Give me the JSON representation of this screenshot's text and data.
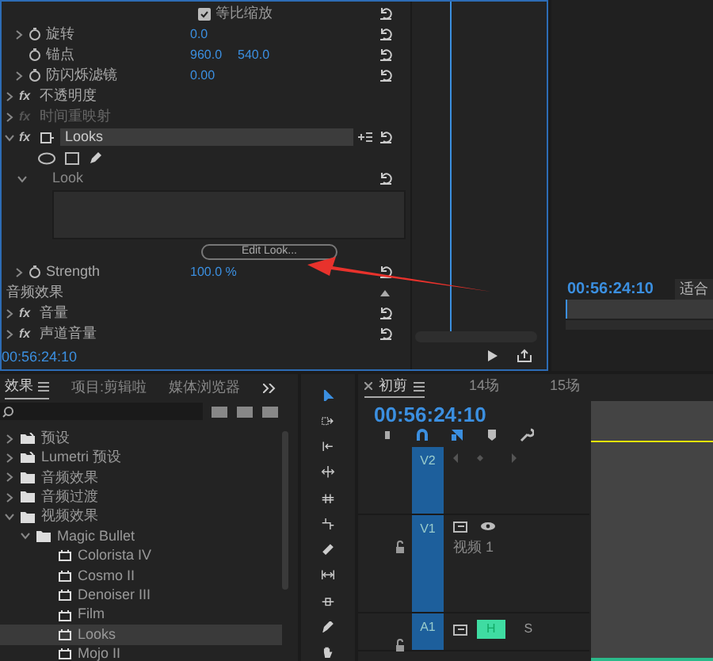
{
  "effect_controls": {
    "rows": [
      {
        "kind": "checkbox",
        "label": "等比缩放",
        "checked": true,
        "reset": true
      },
      {
        "kind": "param",
        "label": "旋转",
        "values": [
          "0.0"
        ],
        "expandable": true,
        "reset": true
      },
      {
        "kind": "param",
        "label": "锚点",
        "values": [
          "960.0",
          "540.0"
        ],
        "expandable": false,
        "reset": true
      },
      {
        "kind": "param",
        "label": "防闪烁滤镜",
        "values": [
          "0.00"
        ],
        "expandable": true,
        "reset": true
      },
      {
        "kind": "effect",
        "badge": "fx",
        "label": "不透明度",
        "expanded": false,
        "enabled": true,
        "selected": false,
        "reset": false
      },
      {
        "kind": "effect",
        "badge": "fx",
        "label": "时间重映射",
        "expanded": false,
        "enabled": false,
        "selected": false,
        "reset": false
      },
      {
        "kind": "effect",
        "badge": "fx",
        "label": "Looks",
        "expanded": true,
        "enabled": true,
        "selected": true,
        "reset": true
      },
      {
        "kind": "masks",
        "reset": false
      },
      {
        "kind": "group",
        "label": "Look",
        "expanded": true,
        "reset": true
      },
      {
        "kind": "preview",
        "reset": false
      },
      {
        "kind": "button",
        "label": "Edit Look...",
        "reset": false
      },
      {
        "kind": "param",
        "label": "Strength",
        "values": [
          "100.0 %"
        ],
        "expandable": true,
        "reset": true
      },
      {
        "kind": "section",
        "label": "音频效果",
        "reset": false
      },
      {
        "kind": "effect",
        "badge": "fx",
        "label": "音量",
        "expanded": false,
        "enabled": true,
        "selected": false,
        "reset": true
      },
      {
        "kind": "effect",
        "badge": "fx",
        "label": "声道音量",
        "expanded": false,
        "enabled": true,
        "selected": false,
        "reset": true
      }
    ],
    "timecode": "00:56:24:10"
  },
  "program_monitor": {
    "timecode": "00:56:24:10",
    "zoom": "适合"
  },
  "effects_panel": {
    "tabs": [
      {
        "label": "效果",
        "selected": true
      },
      {
        "label": "项目:剪辑啦",
        "selected": false
      },
      {
        "label": "媒体浏览器",
        "selected": false
      }
    ],
    "tree": [
      {
        "label": "预设",
        "kind": "preset",
        "expanded": false,
        "selected": false
      },
      {
        "label": "Lumetri 预设",
        "kind": "preset",
        "expanded": false,
        "selected": false
      },
      {
        "label": "音频效果",
        "kind": "folder",
        "expanded": false,
        "selected": false
      },
      {
        "label": "音频过渡",
        "kind": "folder",
        "expanded": false,
        "selected": false
      },
      {
        "label": "视频效果",
        "kind": "folder",
        "expanded": true,
        "selected": false,
        "children": [
          {
            "label": "Magic Bullet",
            "kind": "folder",
            "expanded": true,
            "selected": false,
            "children": [
              {
                "label": "Colorista IV",
                "kind": "effect",
                "selected": false
              },
              {
                "label": "Cosmo II",
                "kind": "effect",
                "selected": false
              },
              {
                "label": "Denoiser III",
                "kind": "effect",
                "selected": false
              },
              {
                "label": "Film",
                "kind": "effect",
                "selected": false
              },
              {
                "label": "Looks",
                "kind": "effect",
                "selected": true
              },
              {
                "label": "Mojo II",
                "kind": "effect",
                "selected": false
              }
            ]
          }
        ]
      }
    ]
  },
  "tools": [
    {
      "kind": "select",
      "selected": true
    },
    {
      "kind": "track",
      "selected": false
    },
    {
      "kind": "ripple",
      "selected": false
    },
    {
      "kind": "rolling",
      "selected": false
    },
    {
      "kind": "rate",
      "selected": false
    },
    {
      "kind": "split",
      "selected": false
    },
    {
      "kind": "razor",
      "selected": false
    },
    {
      "kind": "slip",
      "selected": false
    },
    {
      "kind": "slide",
      "selected": false
    },
    {
      "kind": "pen",
      "selected": false
    },
    {
      "kind": "hand",
      "selected": false
    }
  ],
  "timeline": {
    "tabs": [
      {
        "label": "初剪",
        "selected": true
      },
      {
        "label": "14场",
        "selected": false
      },
      {
        "label": "15场",
        "selected": false
      }
    ],
    "timecode": "00:56:24:10",
    "tracks": [
      {
        "name": "V2",
        "kind": "video",
        "locked": false
      },
      {
        "name": "V1",
        "kind": "video",
        "locked": true,
        "label": "视频 1"
      },
      {
        "name": "A1",
        "kind": "audio",
        "locked": true,
        "buttons": [
          {
            "label": "H",
            "on": true
          },
          {
            "label": "S",
            "on": false
          }
        ]
      }
    ]
  }
}
